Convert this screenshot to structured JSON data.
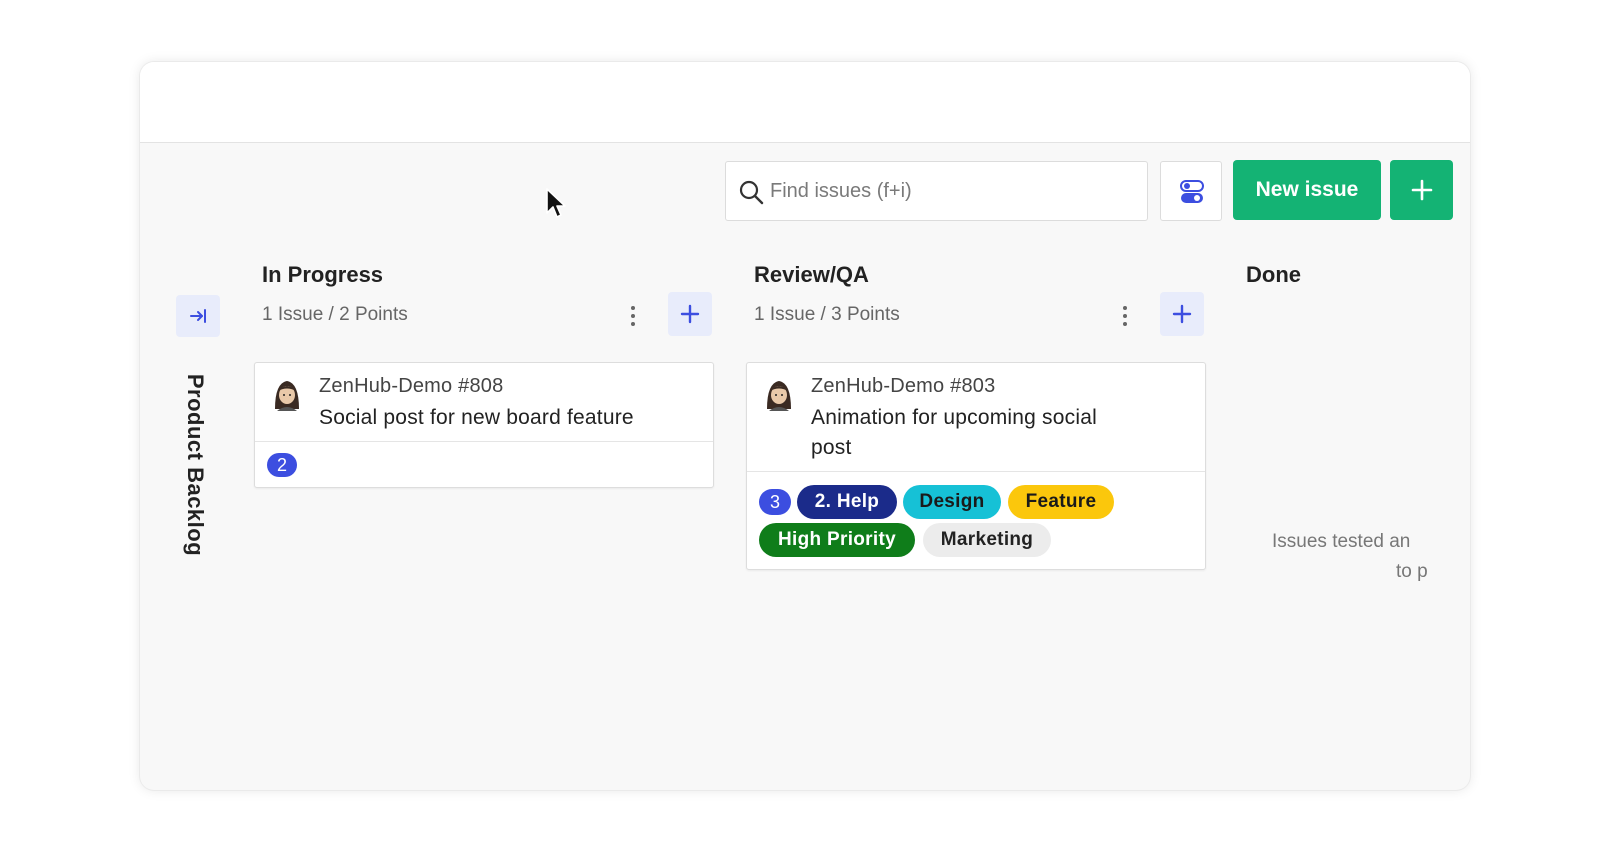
{
  "toolbar": {
    "search_placeholder": "Find issues (f+i)",
    "new_issue_label": "New issue"
  },
  "sidebar": {
    "collapsed_label": "Product Backlog"
  },
  "columns": [
    {
      "name": "In Progress",
      "meta": "1 Issue / 2 Points",
      "cards": [
        {
          "repo": "ZenHub-Demo #808",
          "title": "Social post for new board feature",
          "estimate": "2",
          "labels": []
        }
      ]
    },
    {
      "name": "Review/QA",
      "meta": "1 Issue / 3 Points",
      "cards": [
        {
          "repo": "ZenHub-Demo #803",
          "title_line1": "Animation for upcoming social",
          "title_line2": "post",
          "estimate": "3",
          "labels": [
            {
              "text": "2. Help",
              "bg": "#1b2b8a",
              "fg": "#ffffff"
            },
            {
              "text": "Design",
              "bg": "#16c1d6",
              "fg": "#1a1a1a"
            },
            {
              "text": "Feature",
              "bg": "#fbc70c",
              "fg": "#1a1a1a"
            },
            {
              "text": "High Priority",
              "bg": "#0f7d1a",
              "fg": "#ffffff"
            },
            {
              "text": "Marketing",
              "bg": "#ececec",
              "fg": "#222222"
            }
          ]
        }
      ]
    },
    {
      "name": "Done",
      "empty_line1": "Issues tested an",
      "empty_line2": "to p"
    }
  ],
  "colors": {
    "accent_green": "#14b374",
    "accent_blue": "#3c4ee0",
    "soft_blue_bg": "#e8ecfb"
  }
}
